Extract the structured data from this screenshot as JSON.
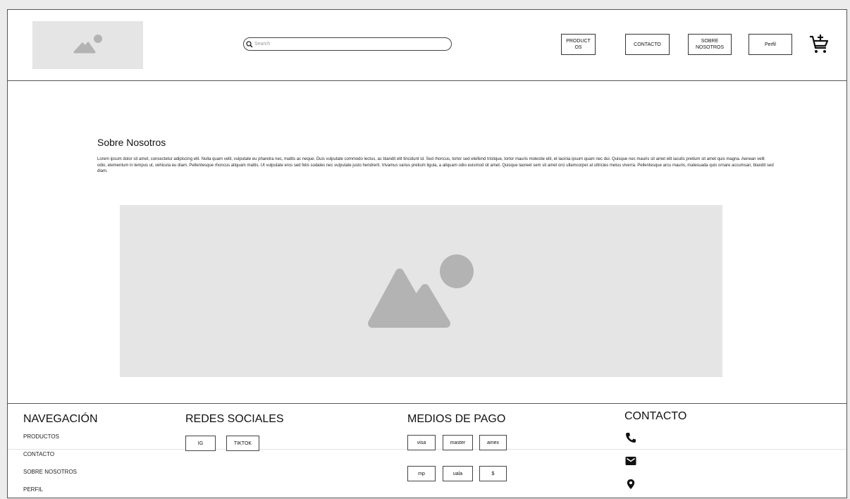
{
  "header": {
    "search_placeholder": "Search",
    "nav": {
      "productos": "PRODUCTOS",
      "contacto": "CONTACTO",
      "sobre_nosotros": "SOBRE NOSOTROS",
      "perfil": "Perfil"
    }
  },
  "main": {
    "title": "Sobre Nosotros",
    "body": "Lorem ipsum dolor sit amet, consectetur adipiscing elit. Nulla quam velit, vulputate eu pharetra nec, mattis ac neque. Duis vulputate commodo lectus, ac blandit elit tincidunt id. Sed rhoncus, tortor sed eleifend tristique, tortor mauris molestie elit, et lacinia ipsum quam nec dui. Quisque nec mauris sit amet elit iaculis pretium sit amet quis magna. Aenean velit odio, elementum in tempus ut, vehicula eu diam. Pellentesque rhoncus aliquam mattis. Ut vulputate eros sed felis sodales nec vulputate justo hendrerit. Vivamus varius pretium ligula, a aliquam odio euismod sit amet. Quisque laoreet sem sit amet orci ullamcorper at ultricies metus viverra. Pellentesque arcu mauris, malesuada quis ornare accumsan, blandit sed diam."
  },
  "footer": {
    "navegacion": {
      "title": "NAVEGACIÓN",
      "links": [
        "PRODUCTOS",
        "CONTACTO",
        "SOBRE NOSOTROS",
        "PERFIL"
      ]
    },
    "redes": {
      "title": "REDES SOCIALES",
      "items": [
        "IG",
        "TIKTOK"
      ]
    },
    "pagos": {
      "title": "MEDIOS DE PAGO",
      "items": [
        "visa",
        "master",
        "amex",
        "mp",
        "uala",
        "$"
      ]
    },
    "contacto": {
      "title": "CONTACTO",
      "icons": [
        "phone-icon",
        "mail-icon",
        "location-icon"
      ]
    }
  },
  "colors": {
    "placeholder_bg": "#e5e5e5",
    "placeholder_icon": "#b3b3b3",
    "border": "#555555"
  }
}
